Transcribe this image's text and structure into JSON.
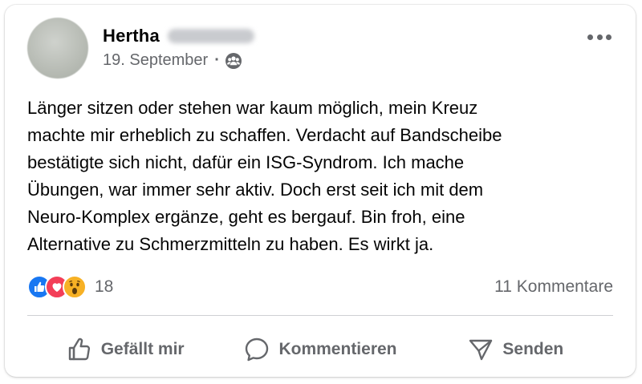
{
  "post": {
    "author_first_name": "Hertha",
    "date": "19. September",
    "separator": "·",
    "audience_icon": "group-icon",
    "text": "Länger sitzen oder stehen war kaum möglich, mein Kreuz\nmachte mir erheblich zu schaffen. Verdacht auf Bandscheibe\nbestätigte sich nicht, dafür ein ISG-Syndrom. Ich mache\nÜbungen, war immer sehr aktiv. Doch erst seit ich mit dem\nNeuro-Komplex ergänze, geht es bergauf. Bin froh, eine\nAlternative zu Schmerzmitteln zu haben. Es wirkt ja."
  },
  "stats": {
    "reactions": [
      "like",
      "love",
      "wow"
    ],
    "reaction_count": "18",
    "comments": "11 Kommentare"
  },
  "actions": {
    "like_label": "Gefällt mir",
    "comment_label": "Kommentieren",
    "share_label": "Senden"
  },
  "colors": {
    "like_blue": "#1877f2",
    "love_red": "#f33e58",
    "wow_yellow": "#f7b125",
    "secondary_text": "#65676b"
  }
}
